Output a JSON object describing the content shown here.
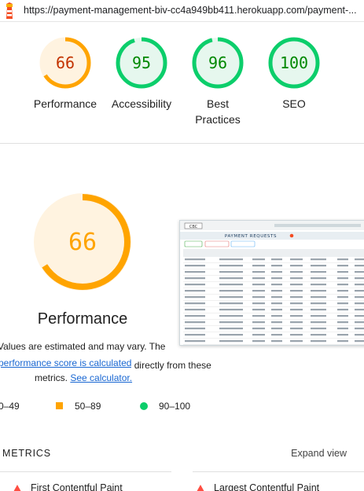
{
  "url_bar": {
    "url": "https://payment-management-biv-cc4a949bb411.herokuapp.com/payment-..."
  },
  "colors": {
    "fail": "#ff4e42",
    "average": "#ffa400",
    "pass": "#0cce6b",
    "link": "#1967d2"
  },
  "scores": [
    {
      "label": "Performance",
      "value": "66",
      "level": 0.66,
      "status": "average"
    },
    {
      "label": "Accessibility",
      "value": "95",
      "level": 0.95,
      "status": "pass"
    },
    {
      "label": "Best Practices",
      "value": "96",
      "level": 0.96,
      "status": "pass"
    },
    {
      "label": "SEO",
      "value": "100",
      "level": 1.0,
      "status": "pass"
    }
  ],
  "performance": {
    "score": "66",
    "level": 0.66,
    "title": "Performance",
    "note_line1": "Values are estimated and may vary. The",
    "note_link1": "performance score is calculated",
    "note_line2_rest": " directly from these",
    "note_line3_pre": "metrics. ",
    "note_link2": "See calculator."
  },
  "legend": {
    "fail": "0–49",
    "average": "50–89",
    "pass": "90–100"
  },
  "metrics": {
    "title": "METRICS",
    "expand_label": "Expand view",
    "items": [
      "First Contentful Paint",
      "Largest Contentful Paint"
    ]
  },
  "screenshot": {
    "brand": "CBC",
    "heading": "PAYMENT REQUESTS"
  }
}
